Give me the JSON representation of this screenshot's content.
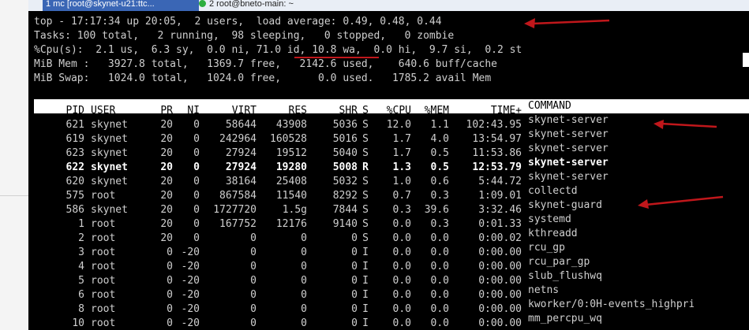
{
  "tabs": [
    {
      "label": "1 mc [root@skynet-u21:ttc..."
    },
    {
      "label": "2 root@bneto-main: ~"
    }
  ],
  "summary": {
    "uptime_line": "top - 17:17:34 up 20:05,  2 users,  load average: 0.49, 0.48, 0.44",
    "tasks_line": "Tasks: 100 total,   2 running,  98 sleeping,   0 stopped,   0 zombie",
    "cpu_line": "%Cpu(s):  2.1 us,  6.3 sy,  0.0 ni, 71.0 id, 10.8 wa,  0.0 hi,  9.7 si,  0.2 st",
    "mem_line": "MiB Mem :   3927.8 total,   1369.7 free,   2142.6 used,    640.6 buff/cache",
    "swap_line": "MiB Swap:   1024.0 total,   1024.0 free,      0.0 used.   1785.2 avail Mem"
  },
  "columns": [
    "PID",
    "USER",
    "PR",
    "NI",
    "VIRT",
    "RES",
    "SHR",
    "S",
    "%CPU",
    "%MEM",
    "TIME+",
    "COMMAND"
  ],
  "processes": [
    {
      "pid": "621",
      "user": "skynet",
      "pr": "20",
      "ni": "0",
      "virt": "58644",
      "res": "43908",
      "shr": "5036",
      "s": "S",
      "cpu": "12.0",
      "mem": "1.1",
      "time": "102:43.95",
      "cmd": "skynet-server"
    },
    {
      "pid": "619",
      "user": "skynet",
      "pr": "20",
      "ni": "0",
      "virt": "242964",
      "res": "160528",
      "shr": "5016",
      "s": "S",
      "cpu": "1.7",
      "mem": "4.0",
      "time": "13:54.97",
      "cmd": "skynet-server"
    },
    {
      "pid": "623",
      "user": "skynet",
      "pr": "20",
      "ni": "0",
      "virt": "27924",
      "res": "19512",
      "shr": "5040",
      "s": "S",
      "cpu": "1.7",
      "mem": "0.5",
      "time": "11:53.86",
      "cmd": "skynet-server"
    },
    {
      "pid": "622",
      "user": "skynet",
      "pr": "20",
      "ni": "0",
      "virt": "27924",
      "res": "19280",
      "shr": "5008",
      "s": "R",
      "cpu": "1.3",
      "mem": "0.5",
      "time": "12:53.79",
      "cmd": "skynet-server"
    },
    {
      "pid": "620",
      "user": "skynet",
      "pr": "20",
      "ni": "0",
      "virt": "38164",
      "res": "25408",
      "shr": "5032",
      "s": "S",
      "cpu": "1.0",
      "mem": "0.6",
      "time": "5:44.72",
      "cmd": "skynet-server"
    },
    {
      "pid": "575",
      "user": "root",
      "pr": "20",
      "ni": "0",
      "virt": "867584",
      "res": "11540",
      "shr": "8292",
      "s": "S",
      "cpu": "0.7",
      "mem": "0.3",
      "time": "1:09.01",
      "cmd": "collectd"
    },
    {
      "pid": "586",
      "user": "skynet",
      "pr": "20",
      "ni": "0",
      "virt": "1727720",
      "res": "1.5g",
      "shr": "7844",
      "s": "S",
      "cpu": "0.3",
      "mem": "39.6",
      "time": "3:32.46",
      "cmd": "skynet-guard"
    },
    {
      "pid": "1",
      "user": "root",
      "pr": "20",
      "ni": "0",
      "virt": "167752",
      "res": "12176",
      "shr": "9140",
      "s": "S",
      "cpu": "0.0",
      "mem": "0.3",
      "time": "0:01.33",
      "cmd": "systemd"
    },
    {
      "pid": "2",
      "user": "root",
      "pr": "20",
      "ni": "0",
      "virt": "0",
      "res": "0",
      "shr": "0",
      "s": "S",
      "cpu": "0.0",
      "mem": "0.0",
      "time": "0:00.02",
      "cmd": "kthreadd"
    },
    {
      "pid": "3",
      "user": "root",
      "pr": "0",
      "ni": "-20",
      "virt": "0",
      "res": "0",
      "shr": "0",
      "s": "I",
      "cpu": "0.0",
      "mem": "0.0",
      "time": "0:00.00",
      "cmd": "rcu_gp"
    },
    {
      "pid": "4",
      "user": "root",
      "pr": "0",
      "ni": "-20",
      "virt": "0",
      "res": "0",
      "shr": "0",
      "s": "I",
      "cpu": "0.0",
      "mem": "0.0",
      "time": "0:00.00",
      "cmd": "rcu_par_gp"
    },
    {
      "pid": "5",
      "user": "root",
      "pr": "0",
      "ni": "-20",
      "virt": "0",
      "res": "0",
      "shr": "0",
      "s": "I",
      "cpu": "0.0",
      "mem": "0.0",
      "time": "0:00.00",
      "cmd": "slub_flushwq"
    },
    {
      "pid": "6",
      "user": "root",
      "pr": "0",
      "ni": "-20",
      "virt": "0",
      "res": "0",
      "shr": "0",
      "s": "I",
      "cpu": "0.0",
      "mem": "0.0",
      "time": "0:00.00",
      "cmd": "netns"
    },
    {
      "pid": "8",
      "user": "root",
      "pr": "0",
      "ni": "-20",
      "virt": "0",
      "res": "0",
      "shr": "0",
      "s": "I",
      "cpu": "0.0",
      "mem": "0.0",
      "time": "0:00.00",
      "cmd": "kworker/0:0H-events_highpri"
    },
    {
      "pid": "10",
      "user": "root",
      "pr": "0",
      "ni": "-20",
      "virt": "0",
      "res": "0",
      "shr": "0",
      "s": "I",
      "cpu": "0.0",
      "mem": "0.0",
      "time": "0:00.00",
      "cmd": "mm_percpu_wq"
    }
  ],
  "colors": {
    "terminal_bg": "#000000",
    "terminal_fg": "#cfcfcf",
    "header_bg": "#ffffff",
    "annotation_red": "#c0171b",
    "active_tab": "#3a66b5"
  }
}
